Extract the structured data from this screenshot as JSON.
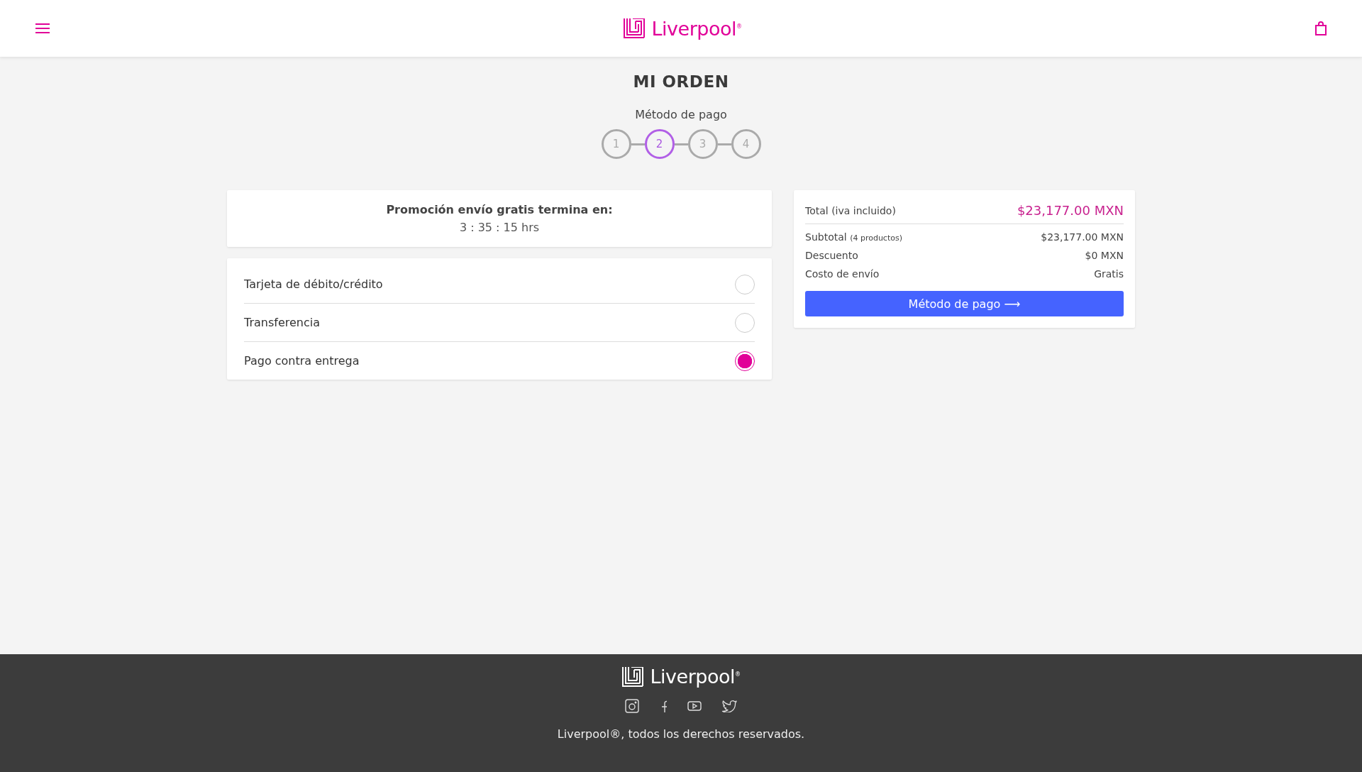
{
  "header": {
    "logo": "Liverpool$^{®}$"
  },
  "page_title": "MI ORDEN",
  "stepper": {
    "current_label": "Método de pago",
    "steps": [
      {
        "label": "1",
        "selected": false
      },
      {
        "label": "2",
        "selected": true
      },
      {
        "label": "3",
        "selected": false
      },
      {
        "label": "4",
        "selected": false
      }
    ]
  },
  "promo": {
    "title": "Promoción envío gratis termina en:",
    "countdown": "3 : 35 : 15 hrs"
  },
  "payment_methods": [
    {
      "label": "Tarjeta de débito/crédito",
      "selected": false
    },
    {
      "label": "Transferencia",
      "selected": false
    },
    {
      "label": "Pago contra entrega",
      "selected": true
    }
  ],
  "summary": {
    "total_label": "Total (iva incluido)",
    "total_value": "$23,177.00 MXN",
    "rows": [
      {
        "label": "Subtotal",
        "note": "(4 productos)",
        "value": "$23,177.00 MXN"
      },
      {
        "label": "Descuento",
        "value": "$0 MXN"
      },
      {
        "label": "Costo de envío",
        "value": "Gratis"
      }
    ],
    "button": "Método de pago ⟶"
  },
  "footer": {
    "logo": "Liverpool$^{®}$",
    "copyright": "Liverpool®, todos los derechos reservados."
  }
}
